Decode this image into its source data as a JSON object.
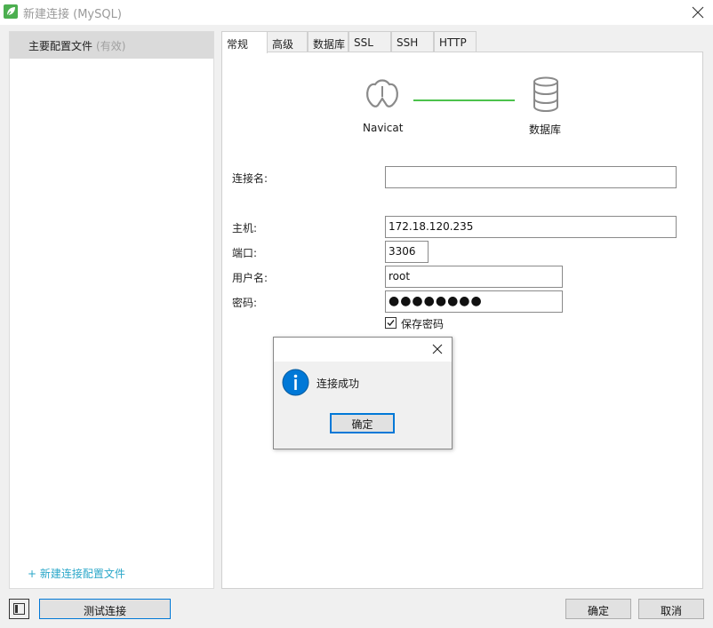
{
  "window": {
    "title": "新建连接 (MySQL)",
    "app_icon": "navicat-leaf-icon",
    "brand_color": "#4caf50"
  },
  "sidebar": {
    "items": [
      {
        "label": "主要配置文件",
        "status": "(有效)"
      }
    ],
    "new_profile_link": "+ 新建连接配置文件",
    "link_color": "#2aa7c9"
  },
  "tabs": [
    {
      "label": "常规",
      "active": true
    },
    {
      "label": "高级",
      "active": false
    },
    {
      "label": "数据库",
      "active": false
    },
    {
      "label": "SSL",
      "active": false
    },
    {
      "label": "SSH",
      "active": false
    },
    {
      "label": "HTTP",
      "active": false
    }
  ],
  "diagram": {
    "left_label": "Navicat",
    "right_label": "数据库",
    "link_color": "#4cc24c"
  },
  "form": {
    "connection_name": {
      "label": "连接名:",
      "value": ""
    },
    "host": {
      "label": "主机:",
      "value": "172.18.120.235"
    },
    "port": {
      "label": "端口:",
      "value": "3306"
    },
    "username": {
      "label": "用户名:",
      "value": "root"
    },
    "password": {
      "label": "密码:",
      "value": "●●●●●●●●"
    },
    "save_password": {
      "label": "保存密码",
      "checked": true
    }
  },
  "dialog": {
    "message": "连接成功",
    "ok_label": "确定",
    "icon": "info-icon",
    "icon_color": "#0078d7"
  },
  "footer": {
    "test_connection_label": "测试连接",
    "ok_label": "确定",
    "cancel_label": "取消"
  }
}
